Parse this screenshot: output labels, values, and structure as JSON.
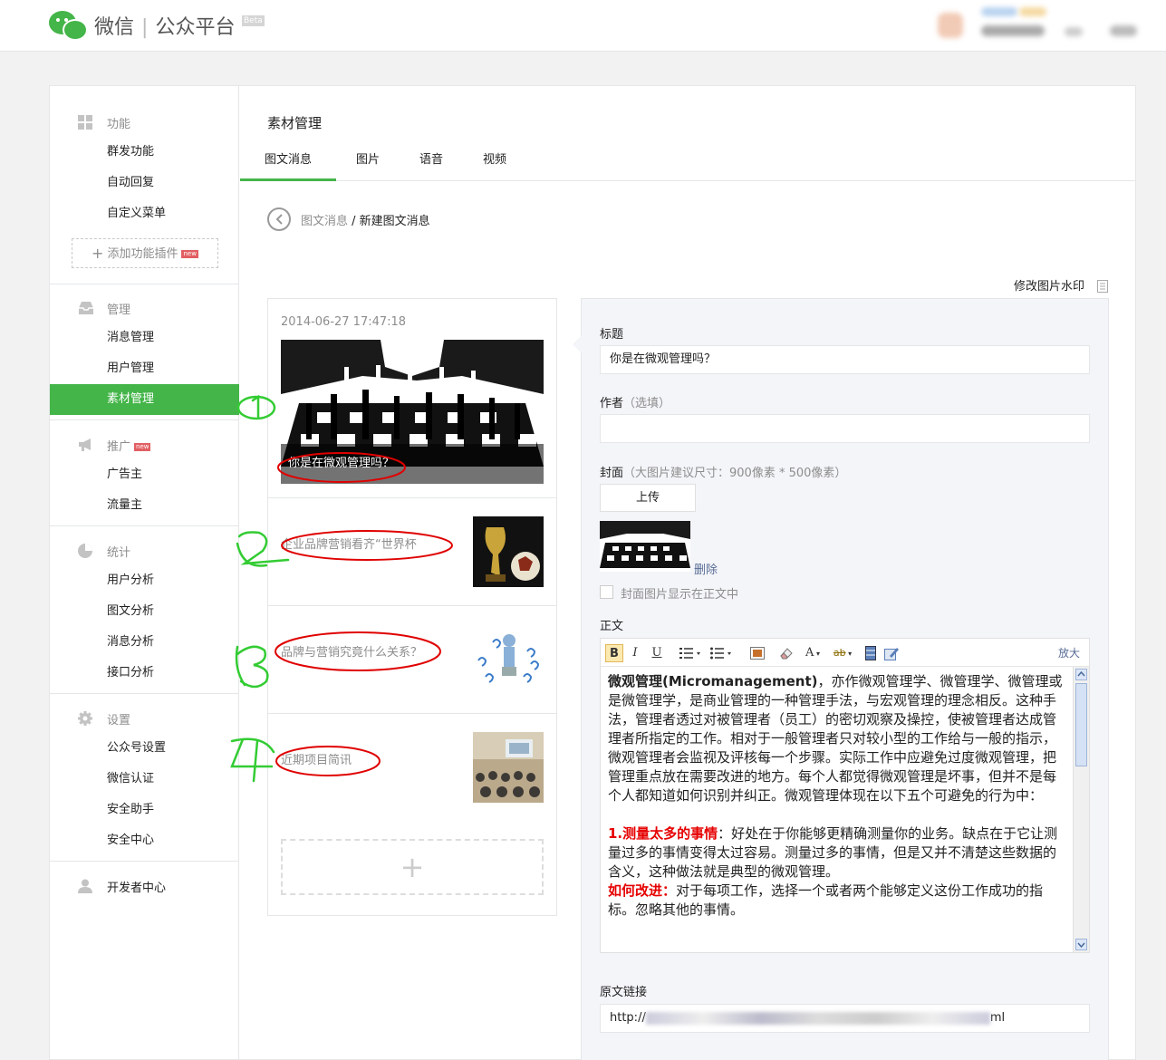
{
  "header": {
    "logo_text_1": "微信",
    "logo_text_2": "公众平台",
    "beta": "Beta"
  },
  "sidebar": {
    "groups": [
      {
        "title": "功能",
        "icon": "grid-icon",
        "items": [
          "群发功能",
          "自动回复",
          "自定义菜单"
        ]
      },
      {
        "title": "管理",
        "icon": "inbox-icon",
        "items": [
          "消息管理",
          "用户管理",
          "素材管理"
        ]
      },
      {
        "title": "推广",
        "icon": "megaphone-icon",
        "badge": "new",
        "items": [
          "广告主",
          "流量主"
        ]
      },
      {
        "title": "统计",
        "icon": "pie-chart-icon",
        "items": [
          "用户分析",
          "图文分析",
          "消息分析",
          "接口分析"
        ]
      },
      {
        "title": "设置",
        "icon": "gear-icon",
        "items": [
          "公众号设置",
          "微信认证",
          "安全助手",
          "安全中心"
        ]
      },
      {
        "title": "开发者中心",
        "icon": "user-icon",
        "items": []
      }
    ],
    "add_plugin": "添加功能插件",
    "add_plugin_badge": "new",
    "active_item": "素材管理"
  },
  "content": {
    "page_title": "素材管理",
    "tabs": [
      "图文消息",
      "图片",
      "语音",
      "视频"
    ],
    "active_tab": "图文消息",
    "breadcrumb": {
      "parent": "图文消息",
      "separator": " / ",
      "current": "新建图文消息"
    },
    "watermark_link": "修改图片水印"
  },
  "article_list": {
    "date": "2014-06-27 17:47:18",
    "cover_title": "你是在微观管理吗？",
    "items": [
      {
        "title": "企业品牌营销看齐“世界杯"
      },
      {
        "title": "品牌与营销究竟什么关系？"
      },
      {
        "title": "近期项目简讯"
      }
    ],
    "add_symbol": "+"
  },
  "editor": {
    "title_label": "标题",
    "title_value": "你是在微观管理吗？",
    "author_label": "作者",
    "author_hint": "（选填）",
    "author_value": "",
    "cover_label": "封面",
    "cover_hint": "（大图片建议尺寸：900像素 * 500像素）",
    "upload_button": "上传",
    "delete_link": "删除",
    "show_cover_label": "封面图片显示在正文中",
    "body_label": "正文",
    "expand_link": "放大",
    "toolbar": {
      "bold": "B",
      "italic": "I",
      "underline": "U",
      "font": "A",
      "highlight": "ab"
    },
    "body": {
      "intro_bold": "微观管理(Micromanagement)",
      "intro_rest": "，亦作微观管理学、微管理学、微管理或是微管理学，是商业管理的一种管理手法，与宏观管理的理念相反。这种手法，管理者透过对被管理者（员工）的密切观察及操控，使被管理者达成管理者所指定的工作。相对于一般管理者只对较小型的工作给与一般的指示，微观管理者会监视及评核每一个步骤。实际工作中应避免过度微观管理，把管理重点放在需要改进的地方。每个人都觉得微观管理是坏事，但并不是每个人都知道如何识别并纠正。微观管理体现在以下五个可避免的行为中：",
      "point1_head": "1.测量太多的事情",
      "point1_rest": "：好处在于你能够更精确测量你的业务。缺点在于它让测量过多的事情变得太过容易。测量过多的事情，但是又并不清楚这些数据的含义，这种做法就是典型的微观管理。",
      "fix_head": "如何改进：",
      "fix_rest": "对于每项工作，选择一个或者两个能够定义这份工作成功的指标。忽略其他的事情。"
    },
    "url_label": "原文链接",
    "url_prefix": "http://",
    "url_suffix": "ml"
  },
  "colors": {
    "brand_green": "#44b549",
    "annotation_green": "#33cc33",
    "annotation_red": "#e00000",
    "link_blue": "#576b95"
  }
}
